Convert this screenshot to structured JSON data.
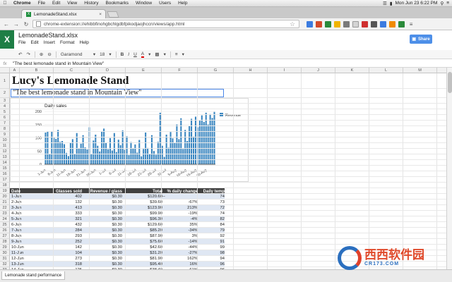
{
  "mac_menubar": {
    "app": "Chrome",
    "menus": [
      "File",
      "Edit",
      "View",
      "History",
      "Bookmarks",
      "Window",
      "Users",
      "Help"
    ],
    "clock": "Mon Jun 23  6:22 PM"
  },
  "browser": {
    "tab_title": "LemonadeStand.xlsx",
    "url": "chrome-extension://ehibbfinohgbchlgdbfpikodjaojhccn/views/app.html"
  },
  "app": {
    "logo": "X",
    "doc_title": "LemonadeStand.xlsx",
    "menus": [
      "File",
      "Edit",
      "Insert",
      "Format",
      "Help"
    ],
    "share_label": "Share",
    "font_name": "Garamond",
    "font_size": "18"
  },
  "formula_bar": {
    "fx": "fx",
    "value": "\"The best lemonade stand in Mountain View\""
  },
  "columns": [
    "A",
    "B",
    "C",
    "D",
    "E",
    "F",
    "G",
    "H",
    "I",
    "J",
    "K",
    "L",
    "M",
    "N",
    "O"
  ],
  "rows": [
    "1",
    "2",
    "3",
    "4",
    "5",
    "6",
    "7",
    "8",
    "9",
    "10",
    "11",
    "12",
    "13",
    "14",
    "15",
    "16",
    "17",
    "18",
    "19",
    "20",
    "21",
    "22",
    "23",
    "24",
    "25",
    "26",
    "27",
    "28",
    "29",
    "30",
    "31",
    "32",
    "33",
    "34"
  ],
  "sheet": {
    "title": "Lucy's Lemonade Stand",
    "subtitle": "\"The best lemonade stand in Mountain View\""
  },
  "table": {
    "headers": [
      "Date",
      "Glasses sold",
      "Revenue / glass",
      "Total",
      "% daily change",
      "Daily temp"
    ],
    "rows": [
      [
        "1-Jun",
        "402",
        "$0.30",
        "$120.60",
        "--",
        "74"
      ],
      [
        "2-Jun",
        "132",
        "$0.30",
        "$39.60",
        "-67%",
        "73"
      ],
      [
        "3-Jun",
        "413",
        "$0.30",
        "$123.90",
        "213%",
        "72"
      ],
      [
        "4-Jun",
        "333",
        "$0.30",
        "$99.90",
        "-19%",
        "74"
      ],
      [
        "5-Jun",
        "321",
        "$0.30",
        "$96.30",
        "-4%",
        "82"
      ],
      [
        "6-Jun",
        "432",
        "$0.30",
        "$129.60",
        "35%",
        "84"
      ],
      [
        "7-Jun",
        "284",
        "$0.30",
        "$85.20",
        "-34%",
        "79"
      ],
      [
        "8-Jun",
        "293",
        "$0.30",
        "$87.90",
        "3%",
        "92"
      ],
      [
        "9-Jun",
        "252",
        "$0.30",
        "$75.60",
        "-14%",
        "91"
      ],
      [
        "10-Jun",
        "142",
        "$0.30",
        "$42.60",
        "-44%",
        "99"
      ],
      [
        "11-Jun",
        "104",
        "$0.30",
        "$31.20",
        "-27%",
        "98"
      ],
      [
        "12-Jun",
        "273",
        "$0.30",
        "$81.90",
        "162%",
        "94"
      ],
      [
        "13-Jun",
        "318",
        "$0.30",
        "$95.40",
        "16%",
        "96"
      ],
      [
        "14-Jun",
        "125",
        "$0.30",
        "$38.40",
        "-61%",
        "96"
      ]
    ]
  },
  "sheet_tab": "Lemonade stand performance",
  "watermark": {
    "text": "西西软件园",
    "sub": "CR173.COM"
  },
  "chart_data": {
    "type": "bar",
    "title": "Daily sales",
    "xlabel": "",
    "ylabel": "",
    "ylim": [
      0,
      200
    ],
    "yticks": [
      0,
      50,
      100,
      150,
      200
    ],
    "legend": "right",
    "series": [
      {
        "name": "Revenue",
        "color": "#3a86c0",
        "values": [
          120,
          123,
          40,
          124,
          100,
          96,
          130,
          85,
          88,
          76,
          43,
          31,
          82,
          95,
          38,
          118,
          60,
          78,
          110,
          64,
          56,
          140,
          40,
          90,
          112,
          70,
          48,
          123,
          135,
          80,
          57,
          99,
          52,
          118,
          46,
          93,
          72,
          128,
          55,
          106,
          35,
          84,
          60,
          75,
          44,
          92,
          30,
          58,
          120,
          62,
          40,
          110,
          50,
          36,
          85,
          195,
          70,
          28,
          112,
          63,
          122,
          98,
          80,
          150,
          95,
          174,
          58,
          130,
          88,
          145,
          172,
          105,
          180,
          140,
          165,
          185,
          160,
          195,
          150,
          190,
          175,
          198
        ]
      }
    ],
    "xticklabels": [
      "1-Jun",
      "6-Jun",
      "11-Jun",
      "16-Jun",
      "21-Jun",
      "26-Jun",
      "1-Jul",
      "6-Jul",
      "11-Jul",
      "16-Jul",
      "21-Jul",
      "26-Jul",
      "31-Jul",
      "5-Aug",
      "10-Aug",
      "15-Aug",
      "20-Aug"
    ]
  }
}
